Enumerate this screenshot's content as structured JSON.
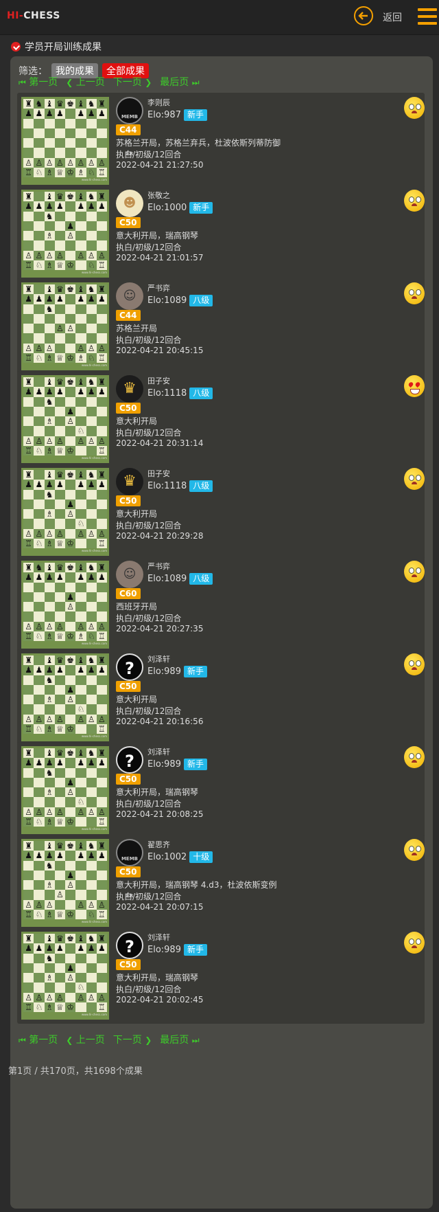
{
  "header": {
    "logo_hi": "HI-",
    "logo_chess": "CHESS",
    "back_label": "返回"
  },
  "section_title": "学员开局训练成果",
  "filter": {
    "label": "筛选：",
    "mine": "我的成果",
    "all": "全部成果"
  },
  "pager": {
    "first": "第一页",
    "prev": "上一页",
    "next": "下一页",
    "last": "最后页"
  },
  "board_caption": "www.hi-chess.com",
  "results": [
    {
      "name": "李则辰",
      "elo": "Elo:987",
      "level": "新手",
      "eco": "C44",
      "opening": "苏格兰开局，苏格兰弃兵，杜波依斯列蒂防御",
      "mode": "执白/初级/12回合",
      "time": "2022-04-21 21:27:50",
      "avatar": "memb",
      "face": "sad",
      "board": [
        "rnbqkbnr",
        "pppp.ppp",
        "........",
        "........",
        "........",
        "........",
        "PPPPPPPP",
        "RNBQKBNR"
      ]
    },
    {
      "name": "张敬之",
      "elo": "Elo:1000",
      "level": "新手",
      "eco": "C50",
      "opening": "意大利开局，瑞高钢琴",
      "mode": "执白/初级/12回合",
      "time": "2022-04-21 21:01:57",
      "avatar": "baby",
      "face": "sad",
      "board": [
        "r.bqkbnr",
        "pppp.ppp",
        "..n.....",
        "....p...",
        "..B.P...",
        "........",
        "PPPP.PPP",
        "RNBQK.NR"
      ]
    },
    {
      "name": "严书弈",
      "elo": "Elo:1089",
      "level": "八级",
      "eco": "C44",
      "opening": "苏格兰开局",
      "mode": "执白/初级/12回合",
      "time": "2022-04-21 20:45:15",
      "avatar": "hair",
      "face": "sad",
      "board": [
        "r.bqkbnr",
        "pppp.ppp",
        "..n.....",
        "........",
        "...PP...",
        "........",
        "PPP..PPP",
        "RNBQKBNR"
      ]
    },
    {
      "name": "田子安",
      "elo": "Elo:1118",
      "level": "八级",
      "eco": "C50",
      "opening": "意大利开局",
      "mode": "执白/初级/12回合",
      "time": "2022-04-21 20:31:14",
      "avatar": "gold",
      "face": "love",
      "board": [
        "r.bqkbnr",
        "pppp.ppp",
        "..n.....",
        "....p...",
        "..B.P...",
        ".....N..",
        "PPPP.PPP",
        "RNBQK..R"
      ]
    },
    {
      "name": "田子安",
      "elo": "Elo:1118",
      "level": "八级",
      "eco": "C50",
      "opening": "意大利开局",
      "mode": "执白/初级/12回合",
      "time": "2022-04-21 20:29:28",
      "avatar": "gold",
      "face": "sad",
      "board": [
        "r.bqkbnr",
        "pppp.ppp",
        "..n.....",
        "....p...",
        "..B.P...",
        ".....N..",
        "PPPP.PPP",
        "RNBQK..R"
      ]
    },
    {
      "name": "严书弈",
      "elo": "Elo:1089",
      "level": "八级",
      "eco": "C60",
      "opening": "西班牙开局",
      "mode": "执白/初级/12回合",
      "time": "2022-04-21 20:27:35",
      "avatar": "hair",
      "face": "sad",
      "board": [
        "rnbqkbnr",
        "pppp.ppp",
        "........",
        "....p...",
        "....P...",
        "........",
        "PPPP.PPP",
        "RNBQKBNR"
      ]
    },
    {
      "name": "刘泽轩",
      "elo": "Elo:989",
      "level": "新手",
      "eco": "C50",
      "opening": "意大利开局",
      "mode": "执白/初级/12回合",
      "time": "2022-04-21 20:16:56",
      "avatar": "q",
      "face": "sad",
      "board": [
        "r.bqkbnr",
        "pppp.ppp",
        "..n.....",
        "....p...",
        "..B.P...",
        ".....N..",
        "PPPP.PPP",
        "RNBQK..R"
      ]
    },
    {
      "name": "刘泽轩",
      "elo": "Elo:989",
      "level": "新手",
      "eco": "C50",
      "opening": "意大利开局，瑞高钢琴",
      "mode": "执白/初级/12回合",
      "time": "2022-04-21 20:08:25",
      "avatar": "q",
      "face": "sad",
      "board": [
        "r.bqkbnr",
        "pppp.ppp",
        "..n.....",
        "....p...",
        "..B.P...",
        ".....N..",
        "PPPP.PPP",
        "RNBQK..R"
      ]
    },
    {
      "name": "翟思齐",
      "elo": "Elo:1002",
      "level": "十级",
      "eco": "C50",
      "opening": "意大利开局，瑞高钢琴 4.d3，杜波依斯变例",
      "mode": "执白/初级/12回合",
      "time": "2022-04-21 20:07:15",
      "avatar": "memb",
      "face": "sad",
      "board": [
        "r.bqkbnr",
        "pppp.ppp",
        "..n.....",
        "....p...",
        "..B.P...",
        "...P....",
        "PPP..PPP",
        "RNBQK.NR"
      ]
    },
    {
      "name": "刘泽轩",
      "elo": "Elo:989",
      "level": "新手",
      "eco": "C50",
      "opening": "意大利开局，瑞高钢琴",
      "mode": "执白/初级/12回合",
      "time": "2022-04-21 20:02:45",
      "avatar": "q",
      "face": "sad",
      "board": [
        "r.bqkbnr",
        "pppp.ppp",
        "..n.....",
        "....p...",
        "..B.P...",
        ".....N..",
        "PPPP.PPP",
        "RNBQK..R"
      ]
    }
  ],
  "footer": "第1页 / 共170页，共1698个成果",
  "colors": {
    "accent": "#f5a000",
    "pager": "#3dcc2a",
    "filter_active": "#e01010",
    "level_badge": "#22b8e8",
    "eco_badge": "#f0a000"
  }
}
